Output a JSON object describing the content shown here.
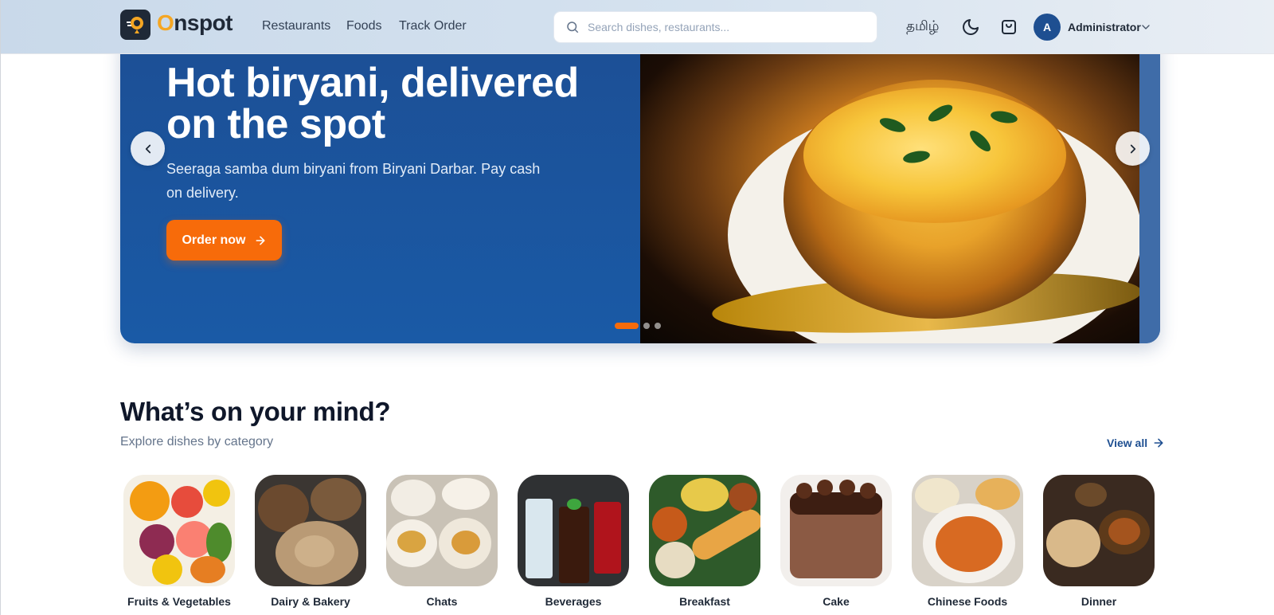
{
  "header": {
    "brand": {
      "prefix": "O",
      "rest": "nspot"
    },
    "nav": [
      {
        "label": "Restaurants"
      },
      {
        "label": "Foods"
      },
      {
        "label": "Track Order"
      }
    ],
    "search": {
      "placeholder": "Search dishes, restaurants...",
      "value": ""
    },
    "language": "தமிழ்",
    "icons": [
      "moon-icon",
      "cart-icon",
      "search-icon",
      "chevron-down-icon"
    ],
    "user": {
      "initial": "A",
      "name": "Administrator"
    }
  },
  "hero": {
    "title": "Hot biryani, delivered on the spot",
    "subtitle": "Seeraga samba dum biryani from Biryani Darbar. Pay cash on delivery.",
    "cta": "Order now",
    "slides": 3,
    "active_slide": 1,
    "colors": {
      "panel": "#1c4f95",
      "accent": "#f76b0a"
    }
  },
  "categories_section": {
    "title": "What’s on your mind?",
    "subtitle": "Explore dishes by category",
    "view_all": "View all",
    "items": [
      {
        "label": "Fruits & Vegetables"
      },
      {
        "label": "Dairy & Bakery"
      },
      {
        "label": "Chats"
      },
      {
        "label": "Beverages"
      },
      {
        "label": "Breakfast"
      },
      {
        "label": "Cake"
      },
      {
        "label": "Chinese Foods"
      },
      {
        "label": "Dinner"
      }
    ]
  }
}
